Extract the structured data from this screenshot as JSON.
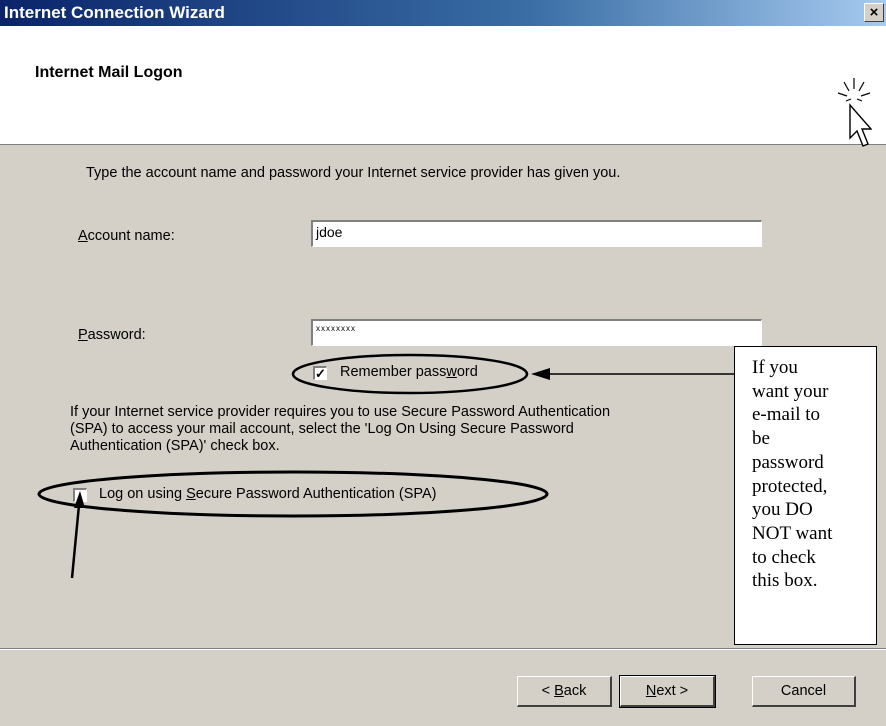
{
  "window": {
    "title": "Internet Connection Wizard",
    "close_glyph": "×"
  },
  "header": {
    "title": "Internet Mail Logon",
    "icon": "wizard-cursor-icon"
  },
  "body": {
    "intro": "Type the account name and password your Internet service provider has given you.",
    "account_label_key": "A",
    "account_label_rest": "ccount name:",
    "account_value": "jdoe",
    "password_label_key": "P",
    "password_label_rest": "assword:",
    "password_value": "xxxxxxxx",
    "remember_pre": "Remember pass",
    "remember_key": "w",
    "remember_post": "ord",
    "remember_checked": true,
    "spa_para_line1": "If your Internet service provider requires you to use Secure Password Authentication",
    "spa_para_line2": "(SPA) to access your mail account, select the 'Log On Using Secure Password",
    "spa_para_line3": "Authentication (SPA)' check box.",
    "spa_pre": "Log on using ",
    "spa_key": "S",
    "spa_post": "ecure Password Authentication (SPA)",
    "spa_checked": false
  },
  "annotation": {
    "note_lines": [
      "If you",
      "want your",
      "e-mail to",
      "be",
      "password",
      "protected,",
      "you DO",
      "NOT want",
      "to check",
      "this box."
    ]
  },
  "buttons": {
    "back_pre": "< ",
    "back_key": "B",
    "back_post": "ack",
    "next_key": "N",
    "next_post": "ext >",
    "cancel": "Cancel"
  }
}
